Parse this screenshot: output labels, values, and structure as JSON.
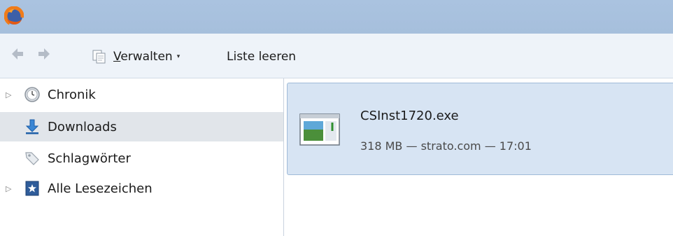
{
  "titlebar": {
    "app_icon": "firefox-icon"
  },
  "toolbar": {
    "back_icon": "back-arrow-icon",
    "forward_icon": "forward-arrow-icon",
    "organize_icon": "copy-icon",
    "organize_label_underlined": "V",
    "organize_label_rest": "erwalten",
    "organize_caret": "▾",
    "clear_label": "Liste leeren"
  },
  "sidebar": {
    "items": [
      {
        "label": "Chronik",
        "icon": "history-clock-icon",
        "expandable": true
      },
      {
        "label": "Downloads",
        "icon": "download-arrow-icon",
        "expandable": false,
        "selected": true
      },
      {
        "label": "Schlagwörter",
        "icon": "tag-icon",
        "expandable": false
      },
      {
        "label": "Alle Lesezeichen",
        "icon": "bookmark-star-icon",
        "expandable": true
      }
    ]
  },
  "downloads": [
    {
      "filename": "CSInst1720.exe",
      "status": "318 MB — strato.com — 17:01",
      "icon": "exe-file-icon"
    }
  ],
  "colors": {
    "titlebar": "#a6bfdc",
    "toolbar": "#eef3f9",
    "selected_row": "#e1e5ea",
    "download_item_bg": "#d7e4f3",
    "download_item_border": "#9fbbd8"
  }
}
